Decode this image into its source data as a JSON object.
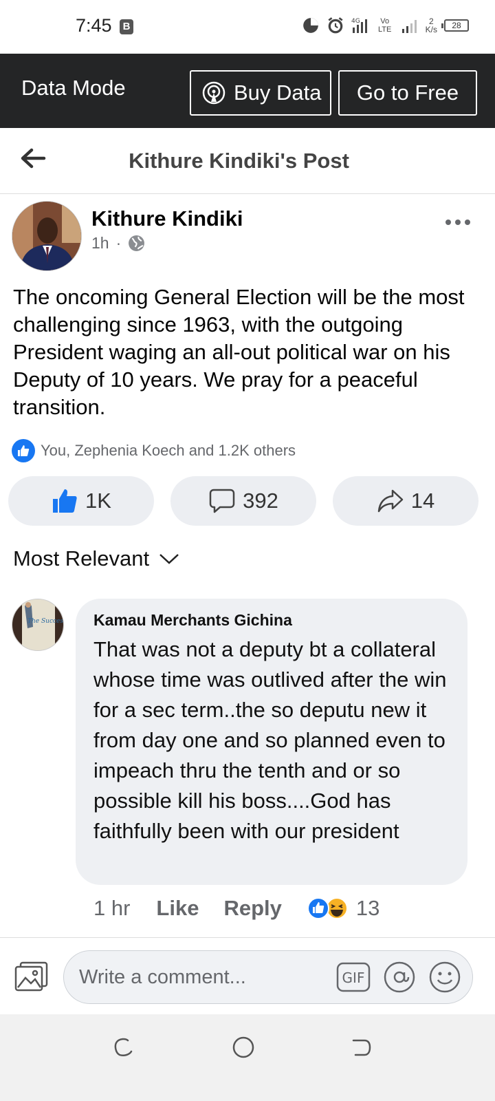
{
  "status_bar": {
    "time": "7:45",
    "b_badge": "B",
    "network_type": "4G",
    "volte": "Vo LTE",
    "speed_value": "2",
    "speed_unit": "K/s",
    "battery": "28"
  },
  "data_bar": {
    "mode_label": "Data Mode",
    "buy_label": "Buy Data",
    "free_label": "Go to Free"
  },
  "header": {
    "title": "Kithure Kindiki's Post"
  },
  "post": {
    "author": "Kithure Kindiki",
    "time": "1h",
    "separator": "·",
    "text": "The oncoming General Election will be the most challenging since 1963, with the outgoing President waging an all-out political war on his Deputy of 10 years. We pray for a peaceful transition.",
    "reactions_summary": "You, Zephenia Koech and 1.2K others",
    "like_count": "1K",
    "comment_count": "392",
    "share_count": "14"
  },
  "sort": {
    "label": "Most Relevant"
  },
  "comment": {
    "author": "Kamau Merchants Gichina",
    "text": "That was not a deputy bt  a collateral whose time was outlived after the win for a sec term..the so deputu new it from day one and so planned even to impeach thru the tenth and or so possible kill his boss....God has faithfully been with our president",
    "time": "1 hr",
    "like_label": "Like",
    "reply_label": "Reply",
    "reaction_count": "13",
    "avatar_book_text": "The Success Principles"
  },
  "composer": {
    "placeholder": "Write a comment...",
    "gif_label": "GIF"
  },
  "colors": {
    "facebook_blue": "#1877f2",
    "data_bar_bg": "#242526",
    "bubble_bg": "#eef0f3",
    "haha_yellow": "#f7b125"
  }
}
